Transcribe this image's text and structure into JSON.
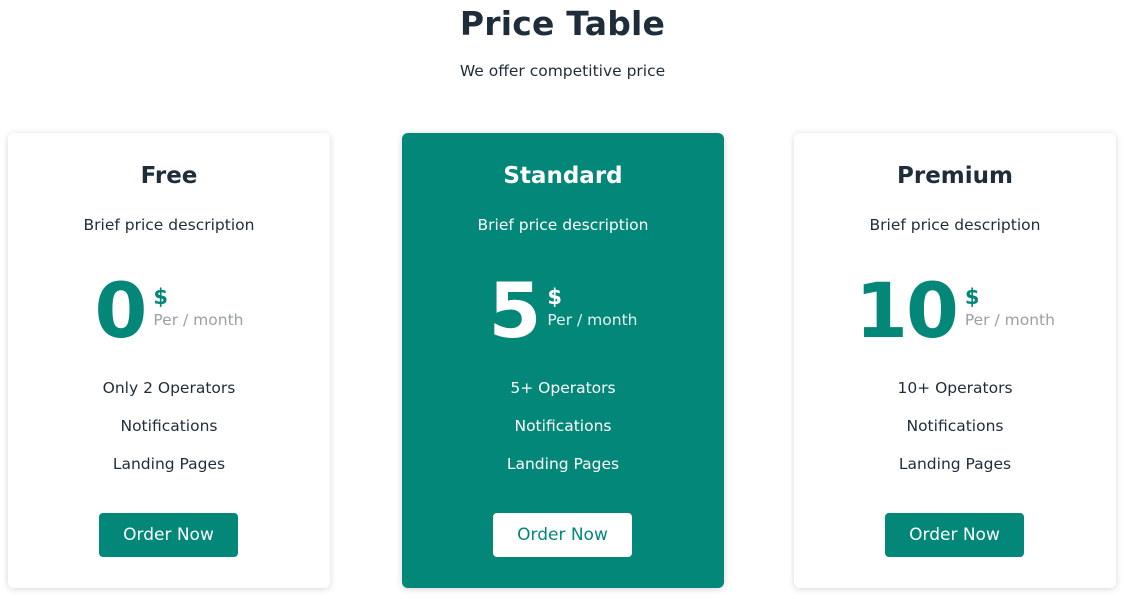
{
  "header": {
    "title": "Price Table",
    "subtitle": "We offer competitive price"
  },
  "plans": [
    {
      "name": "Free",
      "description": "Brief price description",
      "price": "0",
      "currency": "$",
      "period": "Per / month",
      "features": [
        "Only 2 Operators",
        "Notifications",
        "Landing Pages"
      ],
      "button_label": "Order Now"
    },
    {
      "name": "Standard",
      "description": "Brief price description",
      "price": "5",
      "currency": "$",
      "period": "Per / month",
      "features": [
        "5+ Operators",
        "Notifications",
        "Landing Pages"
      ],
      "button_label": "Order Now"
    },
    {
      "name": "Premium",
      "description": "Brief price description",
      "price": "10",
      "currency": "$",
      "period": "Per / month",
      "features": [
        "10+ Operators",
        "Notifications",
        "Landing Pages"
      ],
      "button_label": "Order Now"
    }
  ],
  "colors": {
    "accent": "#028778",
    "text": "#1f2d3a",
    "muted": "#9aa0a6",
    "card_background": "#ffffff"
  }
}
